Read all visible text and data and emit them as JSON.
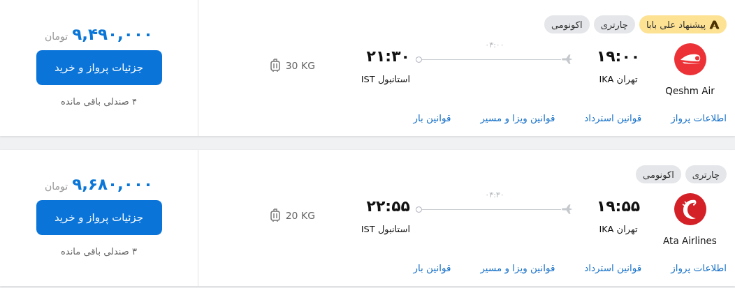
{
  "flights": [
    {
      "badges": [
        {
          "label": "پیشنهاد علی بابا",
          "kind": "offer"
        },
        {
          "label": "چارتری",
          "kind": "plain"
        },
        {
          "label": "اکونومی",
          "kind": "plain"
        }
      ],
      "airline": "Qeshm Air",
      "departure": {
        "time": "۱۹:۰۰",
        "place": "تهران IKA"
      },
      "duration": "۰۳:۰۰",
      "arrival": {
        "time": "۲۱:۳۰",
        "place": "استانبول IST"
      },
      "baggage": "30 KG",
      "links": [
        "اطلاعات پرواز",
        "قوانین استرداد",
        "قوانین ویزا و مسیر",
        "قوانین بار"
      ],
      "price": "۹,۴۹۰,۰۰۰",
      "currency": "تومان",
      "button": "جزئیات پرواز و خرید",
      "seats": "۴ صندلی باقی مانده"
    },
    {
      "badges": [
        {
          "label": "چارتری",
          "kind": "plain"
        },
        {
          "label": "اکونومی",
          "kind": "plain"
        }
      ],
      "airline": "Ata Airlines",
      "departure": {
        "time": "۱۹:۵۵",
        "place": "تهران IKA"
      },
      "duration": "۰۳:۳۰",
      "arrival": {
        "time": "۲۲:۵۵",
        "place": "استانبول IST"
      },
      "baggage": "20 KG",
      "links": [
        "اطلاعات پرواز",
        "قوانین استرداد",
        "قوانین ویزا و مسیر",
        "قوانین بار"
      ],
      "price": "۹,۶۸۰,۰۰۰",
      "currency": "تومان",
      "button": "جزئیات پرواز و خرید",
      "seats": "۳ صندلی باقی مانده"
    }
  ]
}
